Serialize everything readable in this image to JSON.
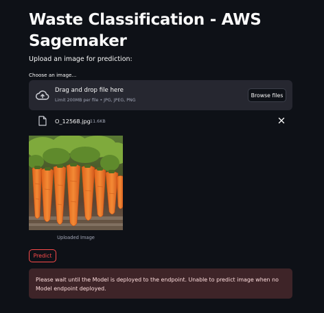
{
  "page": {
    "title": "Waste Classification - AWS Sagemaker",
    "upload_prompt": "Upload an image for prediction:"
  },
  "uploader": {
    "label": "Choose an image...",
    "drop_title": "Drag and drop file here",
    "drop_limits": "Limit 200MB per file • JPG, JPEG, PNG",
    "browse_label": "Browse files",
    "upload_icon": "cloud-upload-icon"
  },
  "file": {
    "name": "O_12568.jpg",
    "size": "11.6KB",
    "file_icon": "file-icon",
    "remove_icon": "close-icon"
  },
  "image": {
    "caption": "Uploaded Image",
    "subject": "carrots"
  },
  "predict_button": {
    "label": "Predict"
  },
  "alert": {
    "message": "Please wait until the Model is deployed to the endpoint. Unable to predict image when no Model endpoint deployed."
  },
  "colors": {
    "background": "#0e1117",
    "dropzone": "#262730",
    "accent": "#ff4b4b",
    "alert_bg": "#3e2428",
    "alert_text": "#ffdede"
  }
}
